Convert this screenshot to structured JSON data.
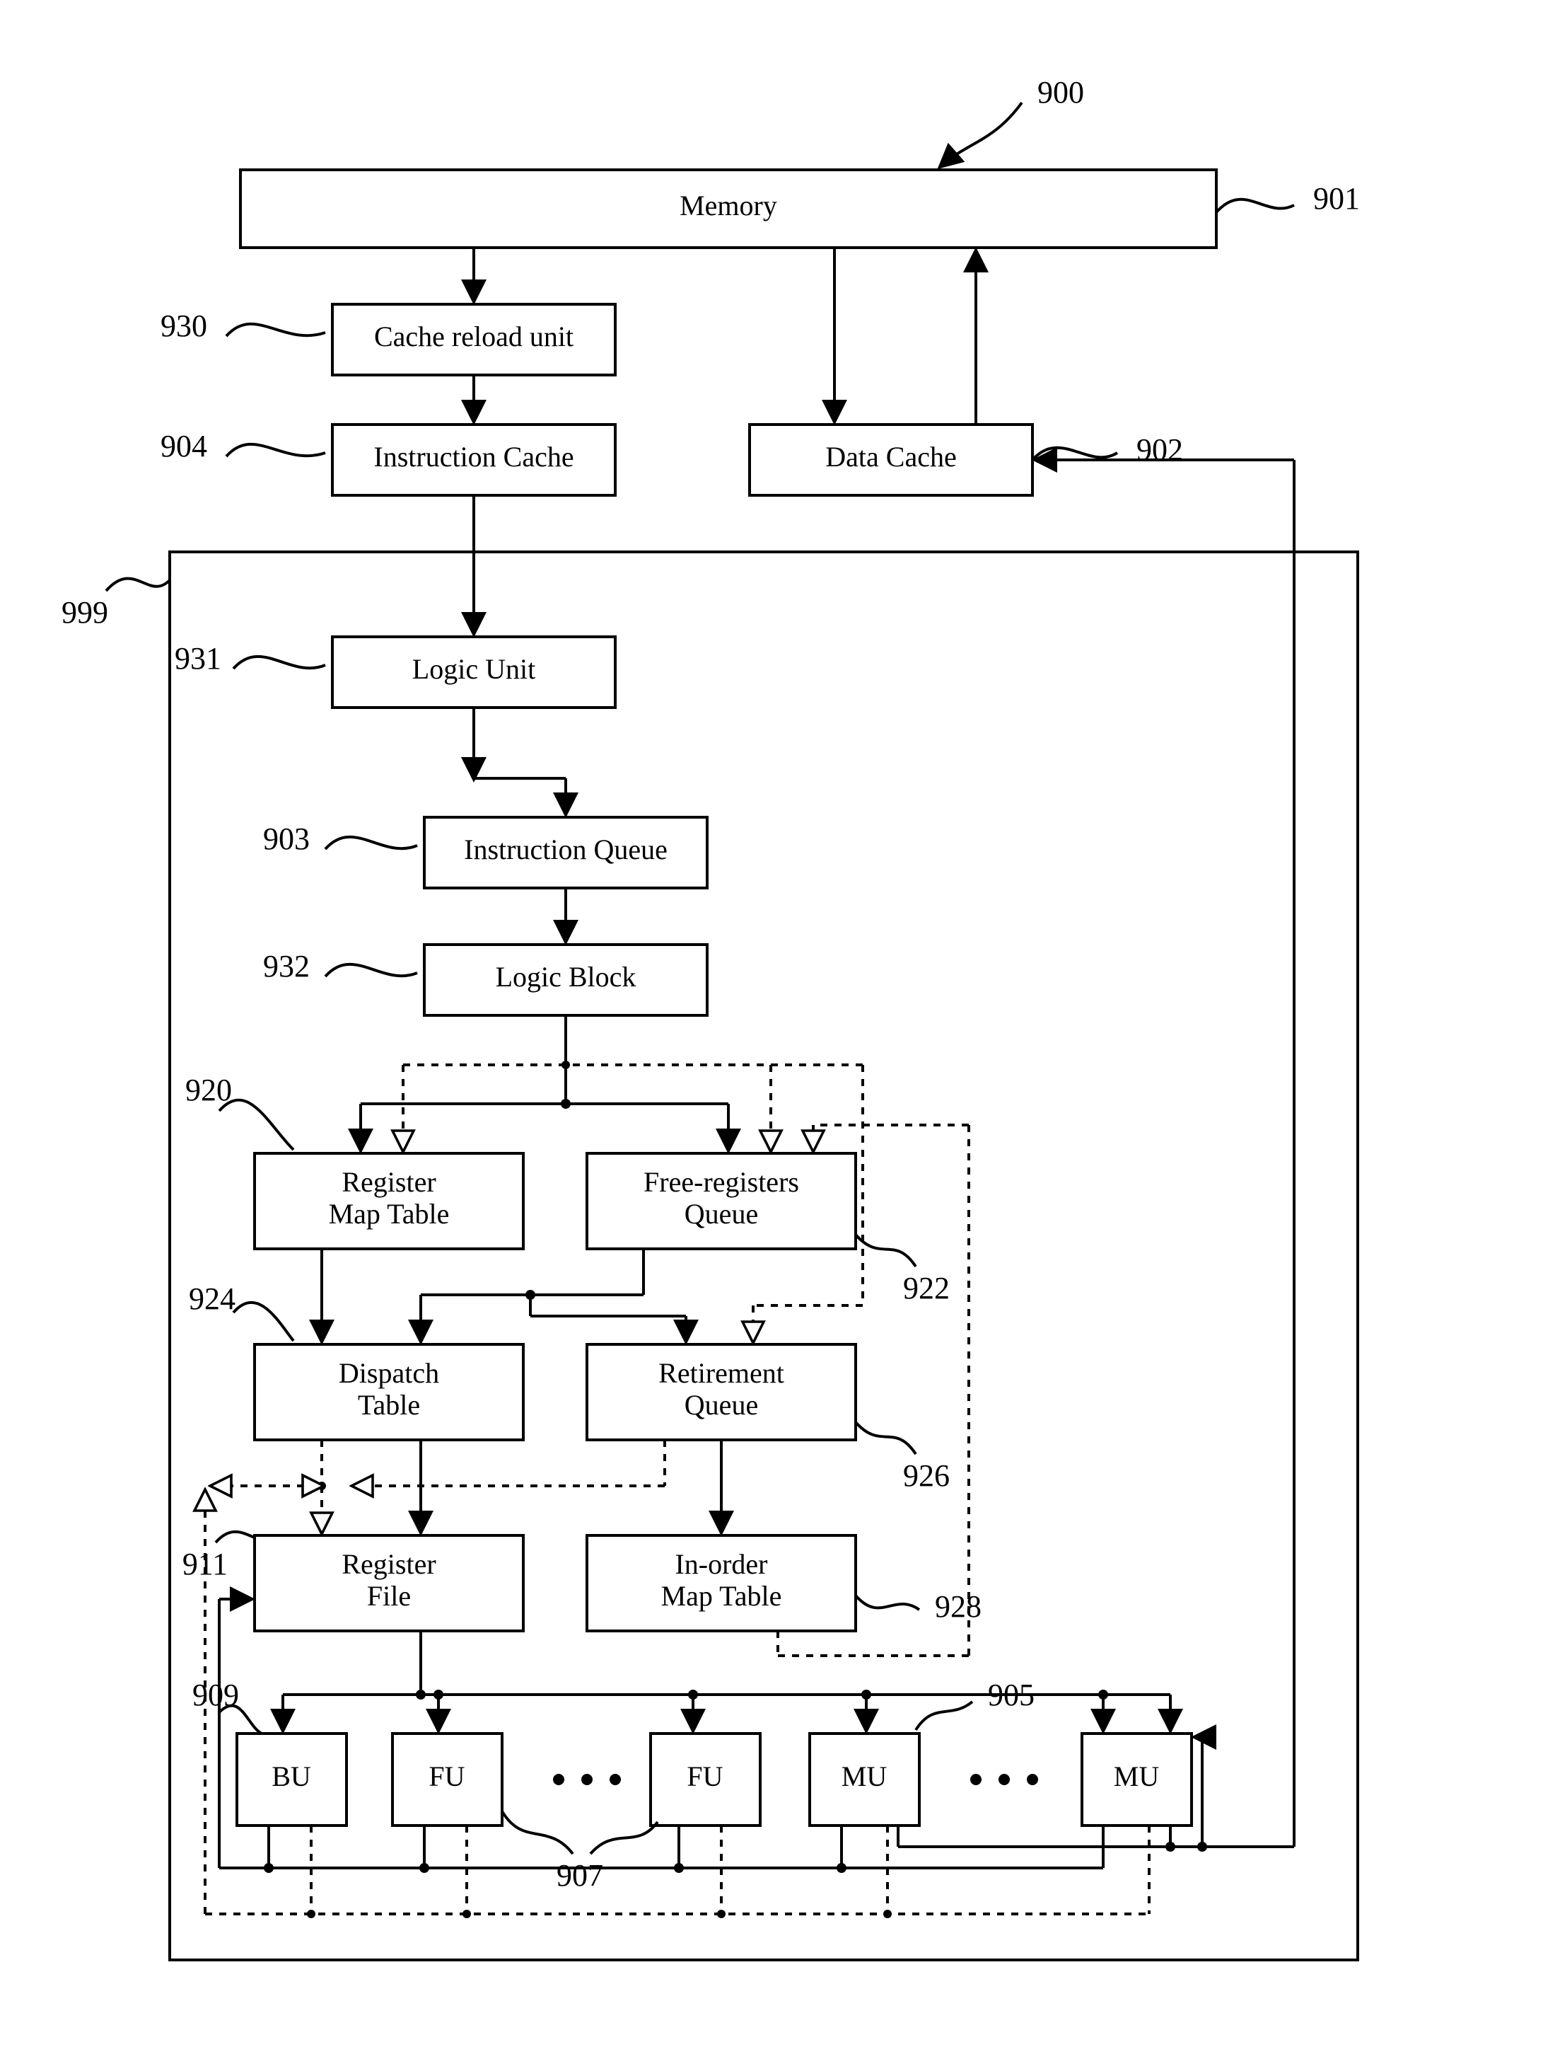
{
  "refs": {
    "ref900": "900",
    "ref901": "901",
    "ref902": "902",
    "ref903": "903",
    "ref904": "904",
    "ref905": "905",
    "ref907": "907",
    "ref909": "909",
    "ref911": "911",
    "ref920": "920",
    "ref922": "922",
    "ref924": "924",
    "ref926": "926",
    "ref928": "928",
    "ref930": "930",
    "ref931": "931",
    "ref932": "932",
    "ref999": "999"
  },
  "blocks": {
    "memory": "Memory",
    "cache_reload_unit": "Cache reload unit",
    "instruction_cache": "Instruction Cache",
    "data_cache": "Data Cache",
    "logic_unit": "Logic Unit",
    "instruction_queue": "Instruction Queue",
    "logic_block": "Logic Block",
    "register_map_table_l1": "Register",
    "register_map_table_l2": "Map Table",
    "free_registers_queue_l1": "Free-registers",
    "free_registers_queue_l2": "Queue",
    "dispatch_table_l1": "Dispatch",
    "dispatch_table_l2": "Table",
    "retirement_queue_l1": "Retirement",
    "retirement_queue_l2": "Queue",
    "register_file_l1": "Register",
    "register_file_l2": "File",
    "in_order_map_table_l1": "In-order",
    "in_order_map_table_l2": "Map Table",
    "BU": "BU",
    "FU": "FU",
    "MU": "MU"
  },
  "symbols": {
    "ellipsis": "• • •"
  }
}
